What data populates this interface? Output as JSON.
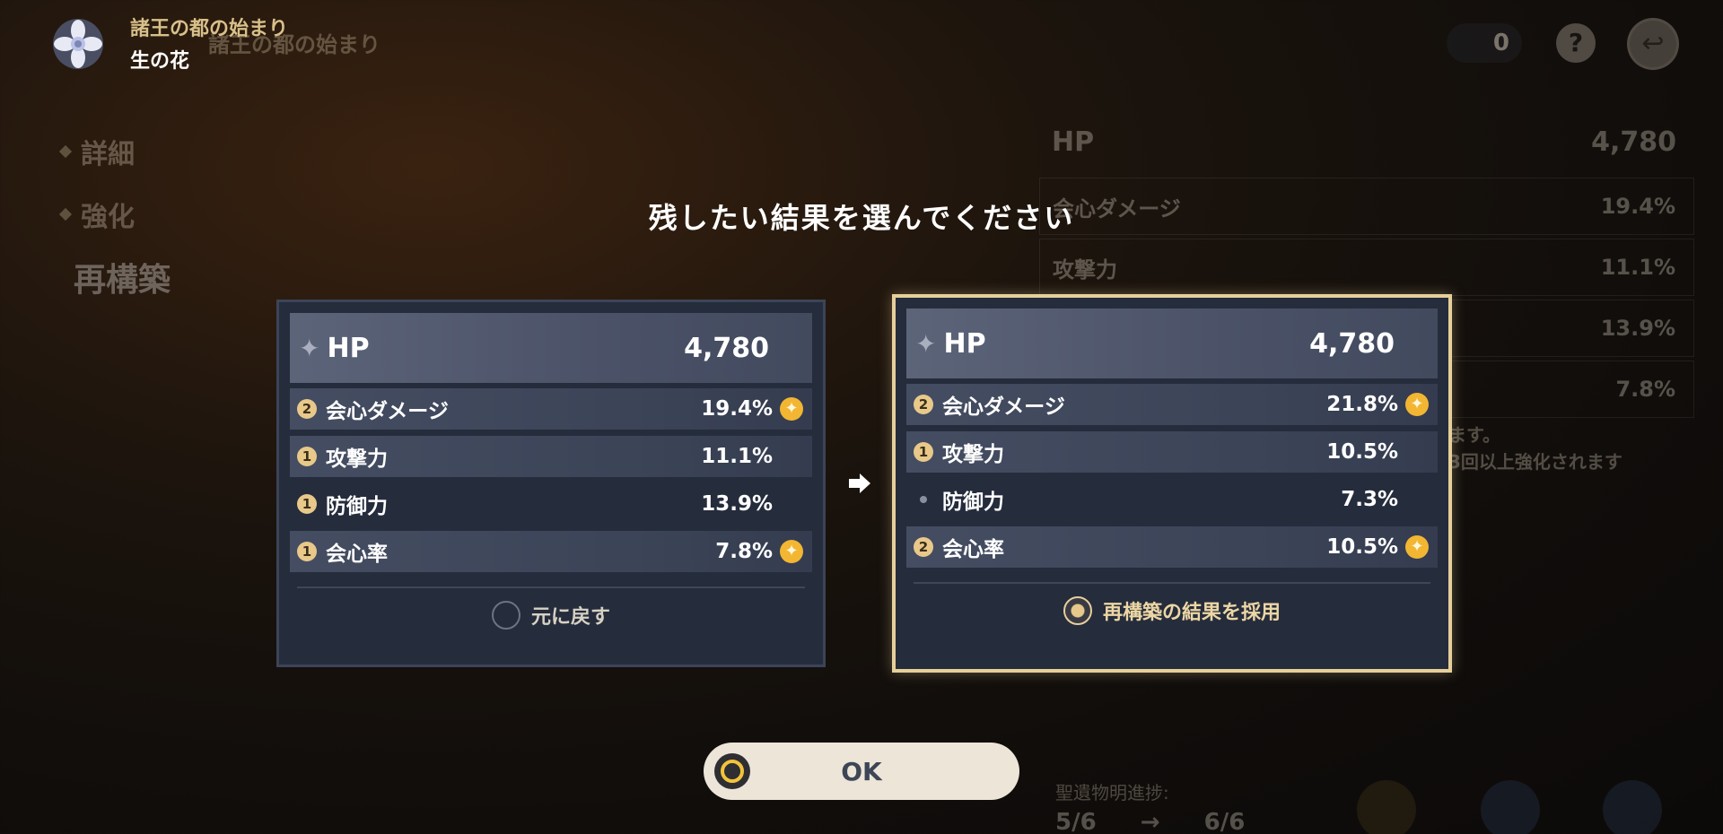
{
  "header": {
    "set_name": "諸王の都の始まり",
    "slot_name": "生の花"
  },
  "background": {
    "breadcrumb": "諸王の都の始まり",
    "nav": [
      "詳細",
      "強化",
      "再構築"
    ],
    "currency_count": "0",
    "stats": [
      {
        "name": "HP",
        "value": "4,780"
      },
      {
        "name": "会心ダメージ",
        "value": "19.4%"
      },
      {
        "name": "攻撃力",
        "value": "11.1%"
      },
      {
        "name": "",
        "value": "13.9%"
      },
      {
        "name": "",
        "value": "7.8%"
      }
    ],
    "note_lines": [
      "ます。",
      "3回以上強化されます"
    ],
    "bottom_label": "聖遺物明進捗:",
    "bottom_progress_from": "5/6",
    "bottom_progress_to": "6/6"
  },
  "dialog": {
    "title": "残したい結果を選んでください",
    "ok_label": "OK"
  },
  "cards": [
    {
      "main": {
        "name": "HP",
        "value": "4,780"
      },
      "subs": [
        {
          "roll": "2",
          "name": "会心ダメージ",
          "value": "19.4%",
          "crit": true
        },
        {
          "roll": "1",
          "name": "攻撃力",
          "value": "11.1%",
          "crit": false
        },
        {
          "roll": "1",
          "name": "防御力",
          "value": "13.9%",
          "crit": false
        },
        {
          "roll": "1",
          "name": "会心率",
          "value": "7.8%",
          "crit": true
        }
      ],
      "option_label": "元に戻す",
      "selected": false
    },
    {
      "main": {
        "name": "HP",
        "value": "4,780"
      },
      "subs": [
        {
          "roll": "2",
          "name": "会心ダメージ",
          "value": "21.8%",
          "crit": true
        },
        {
          "roll": "1",
          "name": "攻撃力",
          "value": "10.5%",
          "crit": false
        },
        {
          "roll": "",
          "name": "防御力",
          "value": "7.3%",
          "crit": false
        },
        {
          "roll": "2",
          "name": "会心率",
          "value": "10.5%",
          "crit": true
        }
      ],
      "option_label": "再構築の結果を採用",
      "selected": true
    }
  ],
  "colors": {
    "selected_border": "#e6cf9a",
    "crit_mark": "#f2b632",
    "roll_badge": "#e8c98a",
    "ok_bg": "#ece5d8"
  }
}
